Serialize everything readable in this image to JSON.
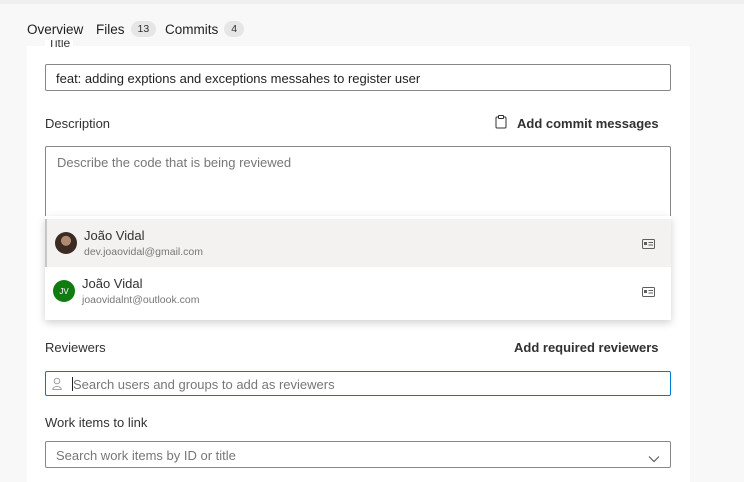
{
  "tabs": [
    {
      "label": "Overview",
      "count": ""
    },
    {
      "label": "Files",
      "count": "13"
    },
    {
      "label": "Commits",
      "count": "4"
    }
  ],
  "form": {
    "title_label": "Title",
    "title_value": "feat: adding exptions and exceptions messahes to register user",
    "description_label": "Description",
    "add_commit_messages": "Add commit messages",
    "description_placeholder": "Describe the code that is being reviewed",
    "reviewers_label": "Reviewers",
    "add_required_reviewers": "Add required reviewers",
    "reviewers_placeholder": "Search users and groups to add as reviewers",
    "work_items_label": "Work items to link",
    "work_items_placeholder": "Search work items by ID or title"
  },
  "suggestions": [
    {
      "name": "João Vidal",
      "email": "dev.joaovidal@gmail.com",
      "initials": "",
      "avatar_type": "photo"
    },
    {
      "name": "João Vidal",
      "email": "joaovidalnt@outlook.com",
      "initials": "JV",
      "avatar_type": "initials",
      "avatar_color": "#107c10"
    }
  ],
  "colors": {
    "accent": "#0078d4"
  },
  "icons": {
    "add_commit": "clipboard-icon",
    "contact_card": "contact-card-icon",
    "person": "person-icon",
    "chevron": "chevron-down-icon"
  }
}
